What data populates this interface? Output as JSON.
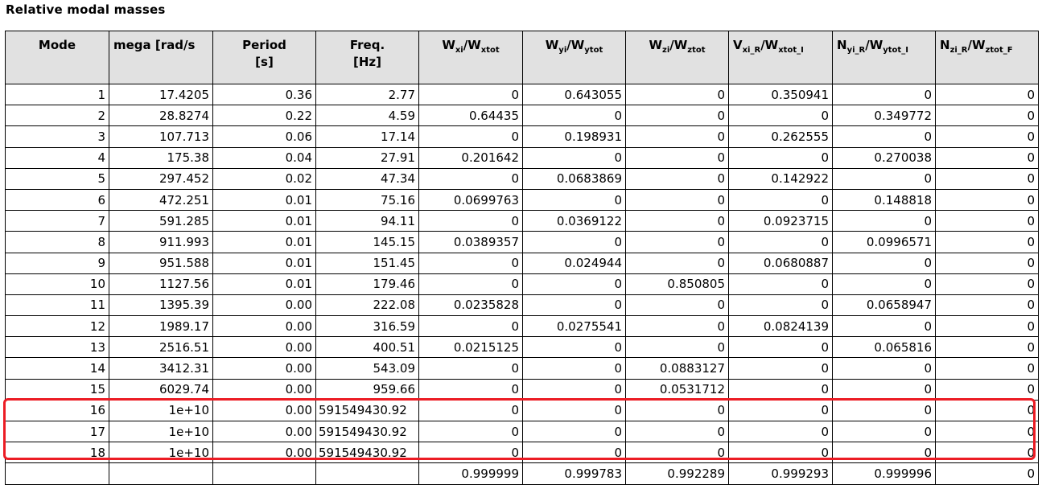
{
  "title": "Relative modal masses",
  "headers": {
    "mode": "Mode",
    "omega": "mega [rad/s",
    "period_l1": "Period",
    "period_l2": "[s]",
    "freq_l1": "Freq.",
    "freq_l2": "[Hz]",
    "wx_a": "W",
    "wx_a_sub": "xi",
    "wx_b": "/W",
    "wx_b_sub": "xtot",
    "wy_a": "W",
    "wy_a_sub": "yi",
    "wy_b": "/W",
    "wy_b_sub": "ytot",
    "wz_a": "W",
    "wz_a_sub": "zi",
    "wz_b": "/W",
    "wz_b_sub": "ztot",
    "wxr_a": "V",
    "wxr_a_sub": "xi_R",
    "wxr_b": "/W",
    "wxr_b_sub": "xtot_I",
    "wyr_a": "N",
    "wyr_a_sub": "yi_R",
    "wyr_b": "/W",
    "wyr_b_sub": "ytot_I",
    "wzr_a": "N",
    "wzr_a_sub": "zi_R",
    "wzr_b": "/W",
    "wzr_b_sub": "ztot_F"
  },
  "rows": [
    [
      "1",
      "17.4205",
      "0.36",
      "2.77",
      "0",
      "0.643055",
      "0",
      "0.350941",
      "0",
      "0"
    ],
    [
      "2",
      "28.8274",
      "0.22",
      "4.59",
      "0.64435",
      "0",
      "0",
      "0",
      "0.349772",
      "0"
    ],
    [
      "3",
      "107.713",
      "0.06",
      "17.14",
      "0",
      "0.198931",
      "0",
      "0.262555",
      "0",
      "0"
    ],
    [
      "4",
      "175.38",
      "0.04",
      "27.91",
      "0.201642",
      "0",
      "0",
      "0",
      "0.270038",
      "0"
    ],
    [
      "5",
      "297.452",
      "0.02",
      "47.34",
      "0",
      "0.0683869",
      "0",
      "0.142922",
      "0",
      "0"
    ],
    [
      "6",
      "472.251",
      "0.01",
      "75.16",
      "0.0699763",
      "0",
      "0",
      "0",
      "0.148818",
      "0"
    ],
    [
      "7",
      "591.285",
      "0.01",
      "94.11",
      "0",
      "0.0369122",
      "0",
      "0.0923715",
      "0",
      "0"
    ],
    [
      "8",
      "911.993",
      "0.01",
      "145.15",
      "0.0389357",
      "0",
      "0",
      "0",
      "0.0996571",
      "0"
    ],
    [
      "9",
      "951.588",
      "0.01",
      "151.45",
      "0",
      "0.024944",
      "0",
      "0.0680887",
      "0",
      "0"
    ],
    [
      "10",
      "1127.56",
      "0.01",
      "179.46",
      "0",
      "0",
      "0.850805",
      "0",
      "0",
      "0"
    ],
    [
      "11",
      "1395.39",
      "0.00",
      "222.08",
      "0.0235828",
      "0",
      "0",
      "0",
      "0.0658947",
      "0"
    ],
    [
      "12",
      "1989.17",
      "0.00",
      "316.59",
      "0",
      "0.0275541",
      "0",
      "0.0824139",
      "0",
      "0"
    ],
    [
      "13",
      "2516.51",
      "0.00",
      "400.51",
      "0.0215125",
      "0",
      "0",
      "0",
      "0.065816",
      "0"
    ],
    [
      "14",
      "3412.31",
      "0.00",
      "543.09",
      "0",
      "0",
      "0.0883127",
      "0",
      "0",
      "0"
    ],
    [
      "15",
      "6029.74",
      "0.00",
      "959.66",
      "0",
      "0",
      "0.0531712",
      "0",
      "0",
      "0"
    ],
    [
      "16",
      "1e+10",
      "0.00",
      "591549430.92",
      "0",
      "0",
      "0",
      "0",
      "0",
      "0"
    ],
    [
      "17",
      "1e+10",
      "0.00",
      "591549430.92",
      "0",
      "0",
      "0",
      "0",
      "0",
      "0"
    ],
    [
      "18",
      "1e+10",
      "0.00",
      "591549430.92",
      "0",
      "0",
      "0",
      "0",
      "0",
      "0"
    ]
  ],
  "totals": [
    "",
    "",
    "",
    "",
    "0.999999",
    "0.999783",
    "0.992289",
    "0.999293",
    "0.999996",
    "0"
  ],
  "highlight": {
    "color": "#ec1c24",
    "rows": [
      "16",
      "17",
      "18"
    ]
  },
  "colors": {
    "header_bg": "#e1e1e1",
    "border": "#000000"
  }
}
